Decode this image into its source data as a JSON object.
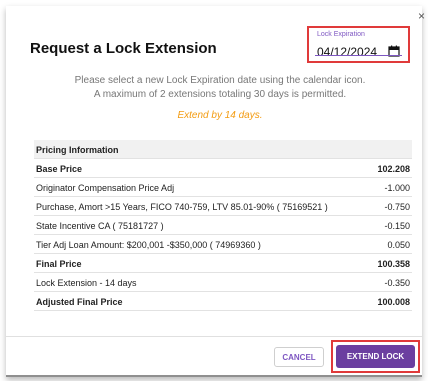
{
  "dialog": {
    "title": "Request a Lock Extension",
    "close_glyph": "×"
  },
  "lock_expiration": {
    "label": "Lock Expiration",
    "value": "04/12/2024",
    "icon": "calendar-icon"
  },
  "instructions": {
    "line1": "Please select a new Lock Expiration date using the calendar icon.",
    "line2": "A maximum of 2 extensions totaling 30 days is permitted.",
    "extend_note": "Extend by 14 days."
  },
  "pricing": {
    "header": "Pricing Information",
    "rows": [
      {
        "label": "Base Price",
        "value": "102.208"
      },
      {
        "label": "Originator Compensation Price Adj",
        "value": "-1.000"
      },
      {
        "label": "Purchase, Amort >15 Years, FICO 740-759, LTV 85.01-90% ( 75169521 )",
        "value": "-0.750"
      },
      {
        "label": "State Incentive CA ( 75181727 )",
        "value": "-0.150"
      },
      {
        "label": "Tier Adj Loan Amount: $200,001 -$350,000 ( 74969360 )",
        "value": "0.050"
      },
      {
        "label": "Final Price",
        "value": "100.358"
      },
      {
        "label": "Lock Extension - 14 days",
        "value": "-0.350"
      },
      {
        "label": "Adjusted Final Price",
        "value": "100.008"
      }
    ]
  },
  "actions": {
    "cancel_label": "CANCEL",
    "extend_label": "EXTEND LOCK"
  },
  "colors": {
    "accent": "#6b3fa0",
    "highlight_border": "#e03a3a",
    "note": "#f39c12"
  }
}
